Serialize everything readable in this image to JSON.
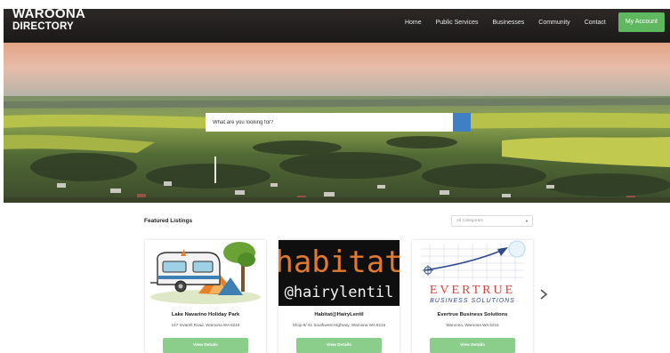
{
  "brand": {
    "line1": "WAROONA",
    "line2": "DIRECTORY"
  },
  "nav": {
    "links": [
      "Home",
      "Public Services",
      "Businesses",
      "Community",
      "Contact"
    ],
    "account": "My Account"
  },
  "search": {
    "placeholder": "What are you looking for?"
  },
  "featured": {
    "title": "Featured Listings",
    "category_select": "All Categories",
    "view_label": "View Details",
    "listings": [
      {
        "name": "Lake Navarino Holiday Park",
        "address": "147 Invarell Road, Waroona WA 6215",
        "image": "caravan-illustration"
      },
      {
        "name": "Habitat@HairyLentil",
        "address": "Shop 6/ 61 Southwest Highway, Waroona WA 6215",
        "image": "habitat-logo",
        "logo_word1": "habitat",
        "logo_word2": "@hairylentil"
      },
      {
        "name": "Evertrue Business Solutions",
        "address": "Waroona, Waroona WA 6215",
        "image": "evertrue-logo",
        "logo_word1": "EVERTRUE",
        "logo_word2": "BUSINESS SOLUTIONS"
      }
    ]
  },
  "colors": {
    "nav_bg": "#221f1e",
    "account_green": "#5fb85f",
    "search_blue": "#3f7fc4",
    "button_green": "#8bcd8b"
  }
}
